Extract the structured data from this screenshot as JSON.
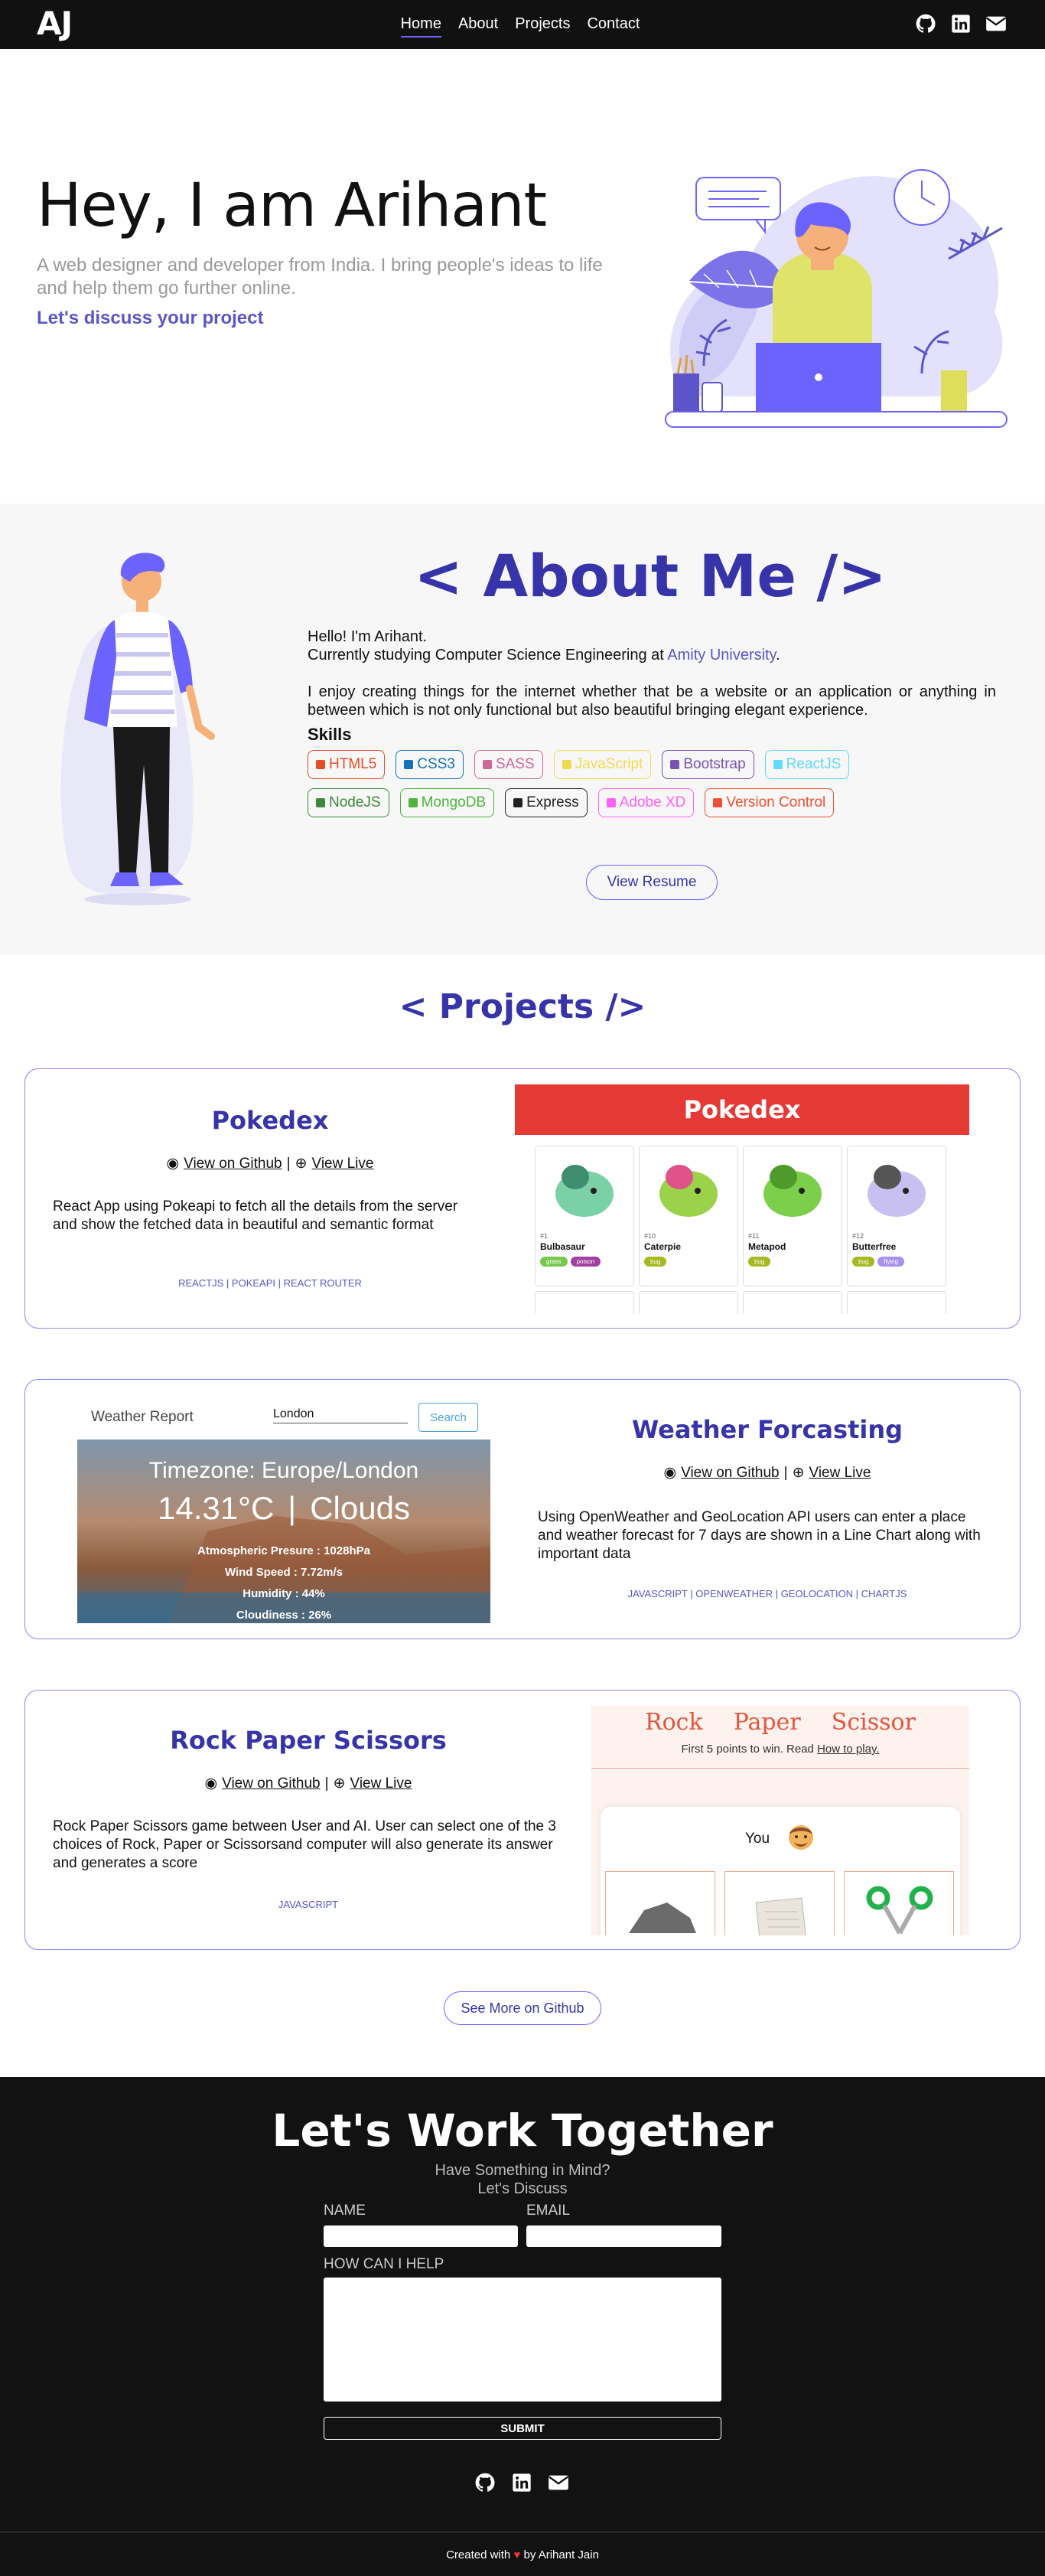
{
  "nav": {
    "logo": "AJ",
    "links": [
      "Home",
      "About",
      "Projects",
      "Contact"
    ],
    "icons": [
      "github-icon",
      "linkedin-icon",
      "mail-icon"
    ]
  },
  "hero": {
    "title": "Hey, I am Arihant",
    "subtitle": "A web designer and developer from India. I bring people's ideas to life and help them go further online.",
    "cta": "Let's discuss your project"
  },
  "about": {
    "title": "< About Me />",
    "greeting": "Hello! I'm Arihant.",
    "study_prefix": "Currently studying Computer Science Engineering at",
    "university": "Amity University",
    "study_suffix": ".",
    "bio": "I enjoy creating things for the internet whether that be a website or an application or anything in between which is not only functional but also beautiful bringing elegant experience.",
    "skills_title": "Skills",
    "skills": [
      {
        "label": "HTML5",
        "color": "#e44d26"
      },
      {
        "label": "CSS3",
        "color": "#1572b6"
      },
      {
        "label": "SASS",
        "color": "#cd6799"
      },
      {
        "label": "JavaScript",
        "color": "#f0db4f"
      },
      {
        "label": "Bootstrap",
        "color": "#7952b3"
      },
      {
        "label": "ReactJS",
        "color": "#61dafb"
      },
      {
        "label": "NodeJS",
        "color": "#3c873a"
      },
      {
        "label": "MongoDB",
        "color": "#4db33d"
      },
      {
        "label": "Express",
        "color": "#222222"
      },
      {
        "label": "Adobe XD",
        "color": "#ff61f6"
      },
      {
        "label": "Version Control",
        "color": "#f05033"
      }
    ],
    "resume": "View Resume"
  },
  "projects": {
    "title": "< Projects />",
    "github_label": "View on Github",
    "live_label": "View Live",
    "items": [
      {
        "title": "Pokedex",
        "desc": "React App using Pokeapi to fetch all the details from the server and show the fetched data in beautiful and semantic format",
        "tags": "REACTJS | POKEAPI | REACT ROUTER",
        "shot": {
          "header": "Pokedex",
          "cards": [
            {
              "num": "#1",
              "name": "Bulbasaur",
              "types": [
                "grass",
                "poison"
              ]
            },
            {
              "num": "#10",
              "name": "Caterpie",
              "types": [
                "bug"
              ]
            },
            {
              "num": "#11",
              "name": "Metapod",
              "types": [
                "bug"
              ]
            },
            {
              "num": "#12",
              "name": "Butterfree",
              "types": [
                "bug",
                "flying"
              ]
            }
          ]
        }
      },
      {
        "title": "Weather Forcasting",
        "desc": "Using OpenWeather and GeoLocation API users can enter a place and weather forecast for 7 days are shown in a Line Chart along with important data",
        "tags": "JAVASCRIPT | OPENWEATHER | GEOLOCATION | CHARTJS",
        "shot": {
          "app_title": "Weather Report",
          "search_value": "London",
          "search_button": "Search",
          "timezone": "Timezone: Europe/London",
          "temp": "14.31°C",
          "sep": "|",
          "condition": "Clouds",
          "pressure": "Atmospheric Presure : 1028hPa",
          "wind": "Wind Speed : 7.72m/s",
          "humidity": "Humidity : 44%",
          "cloudiness": "Cloudiness : 26%"
        }
      },
      {
        "title": "Rock Paper Scissors",
        "desc": "Rock Paper Scissors game between User and AI. User can select one of the 3 choices of Rock, Paper or Scissorsand computer will also generate its answer and generates a score",
        "tags": "JAVASCRIPT",
        "shot": {
          "header_words": [
            "Rock",
            "Paper",
            "Scissor"
          ],
          "rule_prefix": "First 5 points to win. Read",
          "rule_link": "How to play.",
          "you": "You"
        }
      }
    ],
    "see_more": "See More on Github"
  },
  "contact": {
    "title": "Let's Work Together",
    "sub1": "Have Something in Mind?",
    "sub2": "Let's Discuss",
    "name_label": "NAME",
    "email_label": "EMAIL",
    "help_label": "HOW CAN I HELP",
    "submit": "SUBMIT"
  },
  "footer": {
    "prefix": "Created with",
    "heart": "♥",
    "suffix": "by Arihant Jain"
  }
}
